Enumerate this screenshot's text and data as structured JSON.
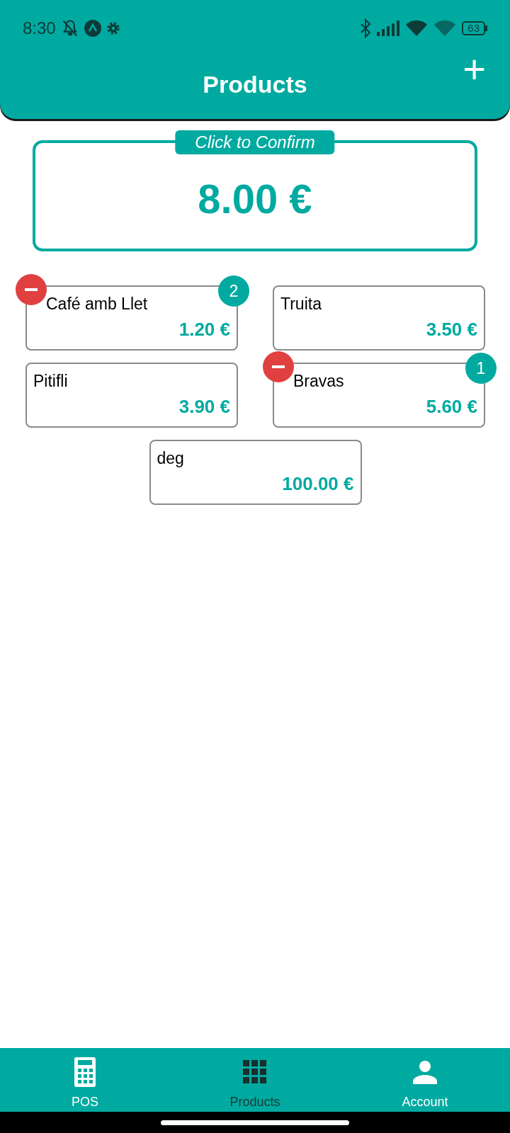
{
  "status_bar": {
    "time": "8:30",
    "battery": "63"
  },
  "header": {
    "title": "Products",
    "add_button": "+"
  },
  "confirm": {
    "label": "Click to Confirm",
    "total": "8.00 €"
  },
  "products": [
    {
      "name": "Café amb Llet",
      "price": "1.20 €",
      "count": "2"
    },
    {
      "name": "Truita",
      "price": "3.50 €"
    },
    {
      "name": "Pitifli",
      "price": "3.90 €"
    },
    {
      "name": "Bravas",
      "price": "5.60 €",
      "count": "1"
    },
    {
      "name": "deg",
      "price": "100.00 €"
    }
  ],
  "nav": [
    {
      "label": "POS",
      "selected": false
    },
    {
      "label": "Products",
      "selected": true
    },
    {
      "label": "Account",
      "selected": false
    }
  ]
}
